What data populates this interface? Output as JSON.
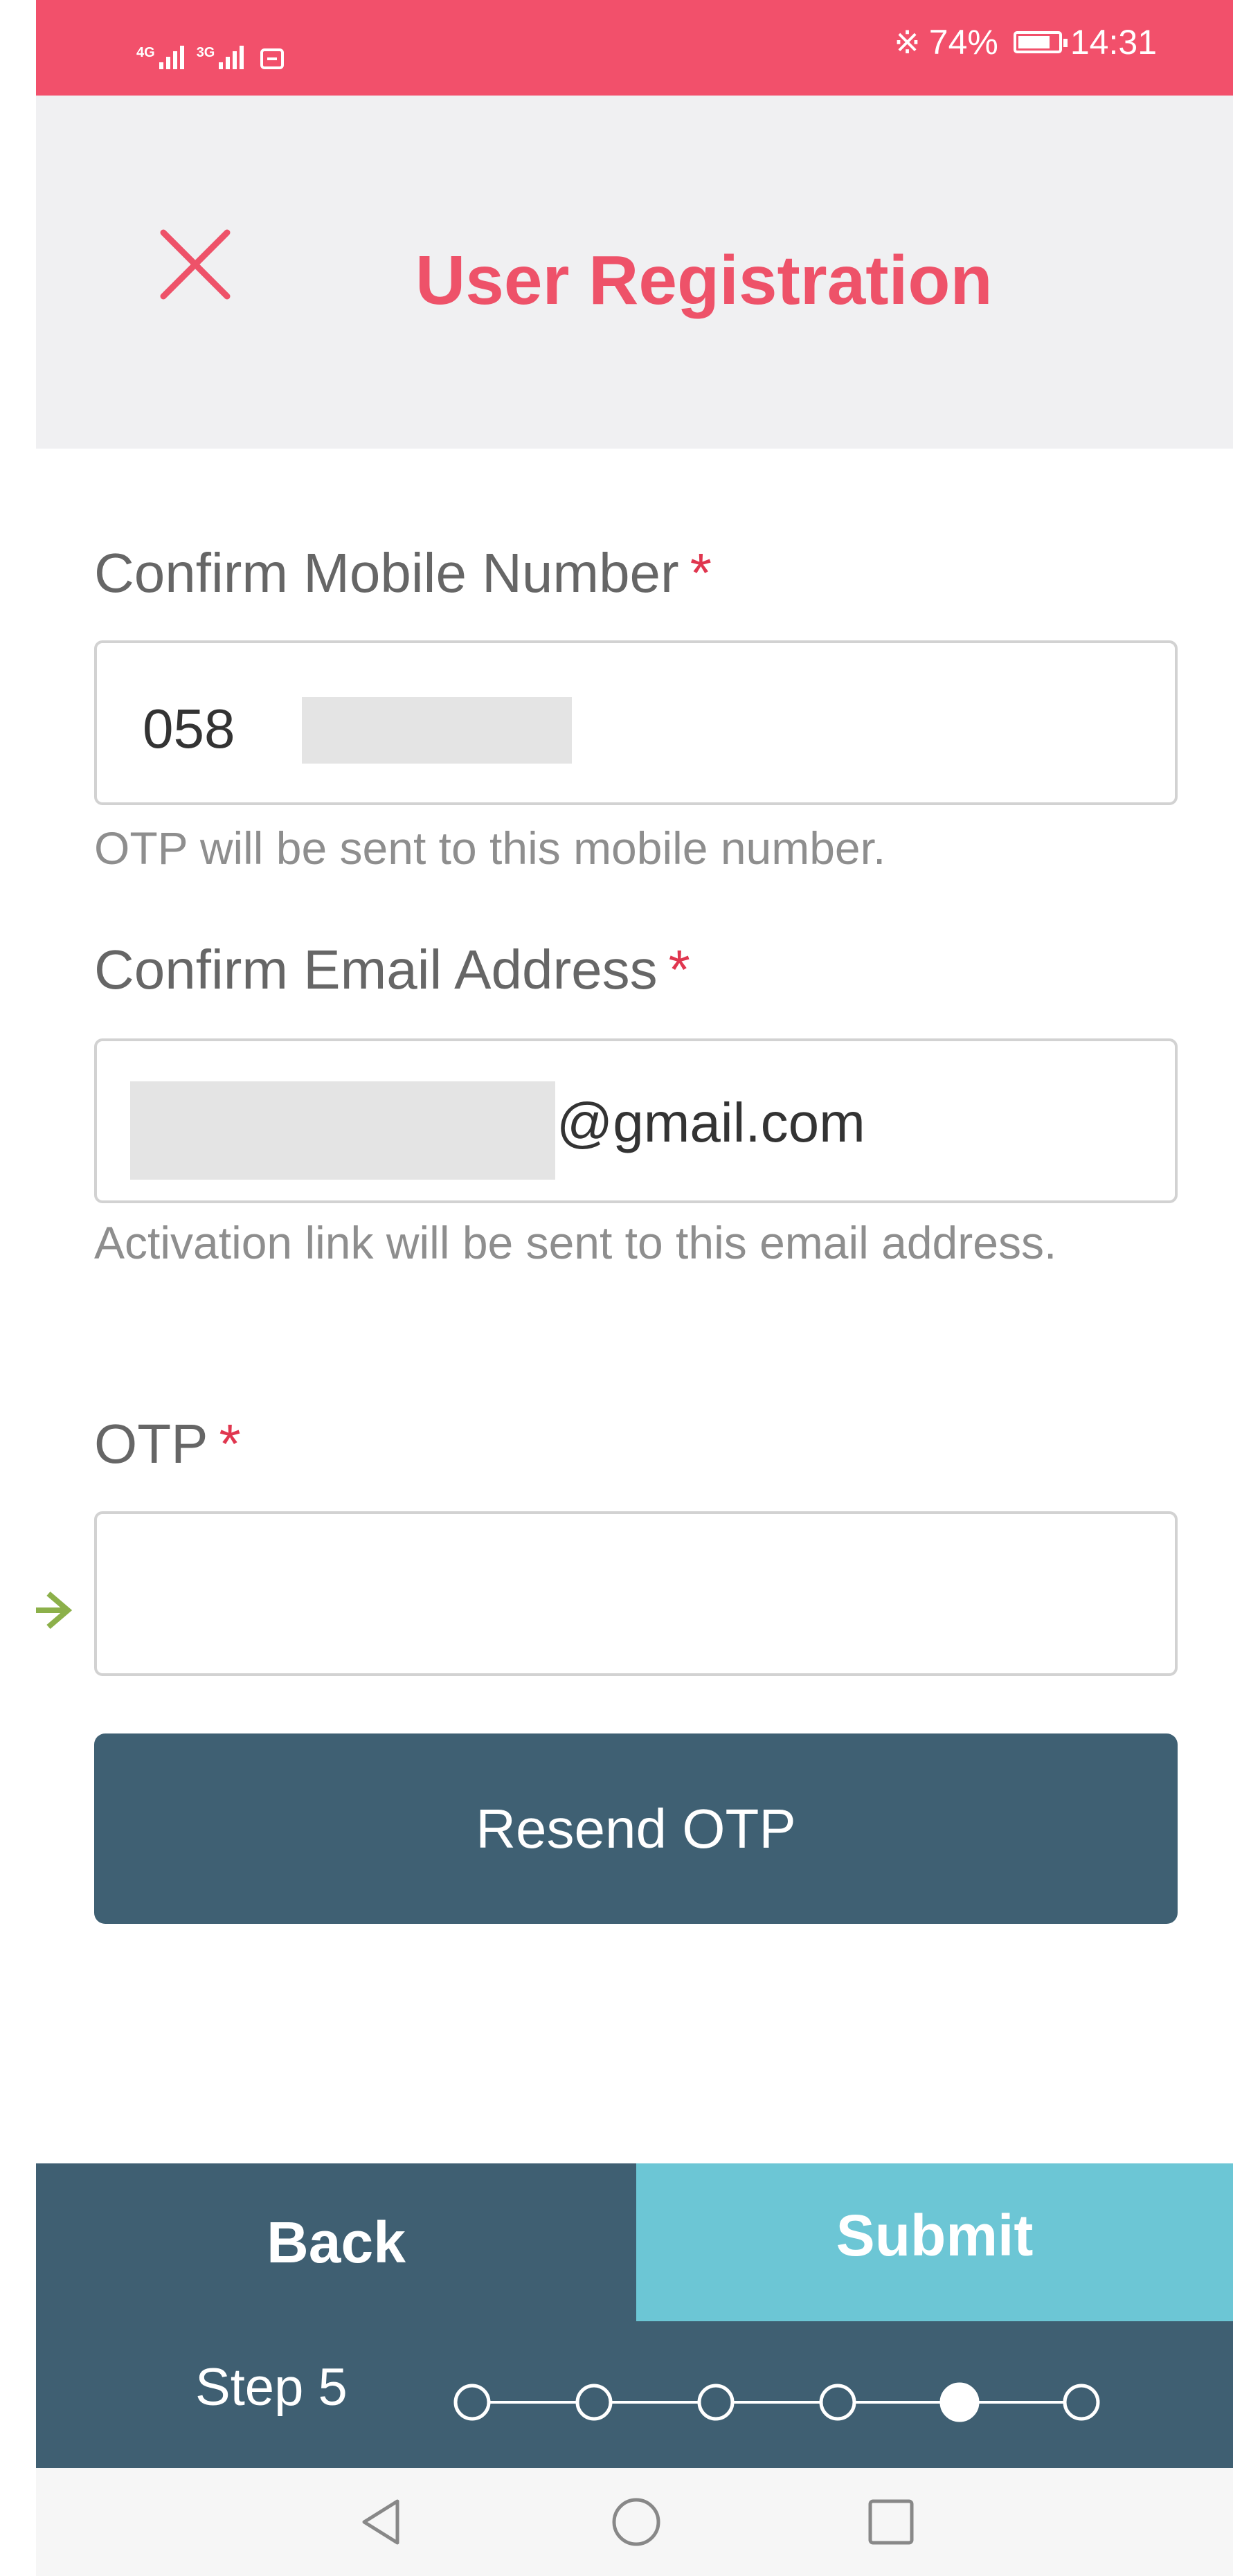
{
  "status_bar": {
    "signal_1": "4G",
    "signal_2": "3G",
    "battery_percent": "74%",
    "time": "14:31"
  },
  "header": {
    "title": "User Registration",
    "close_icon": "close-icon"
  },
  "form": {
    "mobile": {
      "label": "Confirm Mobile Number",
      "required_mark": "*",
      "value": "058",
      "hint": "OTP will be sent to this mobile number."
    },
    "email": {
      "label": "Confirm Email Address",
      "required_mark": "*",
      "value": "@gmail.com",
      "hint": "Activation link will be sent to this email address."
    },
    "otp": {
      "label": "OTP",
      "required_mark": "*",
      "value": ""
    },
    "resend_label": "Resend OTP"
  },
  "footer": {
    "back_label": "Back",
    "submit_label": "Submit",
    "step_label": "Step 5",
    "step_total": 6,
    "step_current": 5
  },
  "colors": {
    "accent": "#f2506b",
    "title": "#ee5269",
    "primary_dark": "#3f5f72",
    "submit": "#6cc6d5",
    "annotation_arrow": "#8cb04a"
  }
}
